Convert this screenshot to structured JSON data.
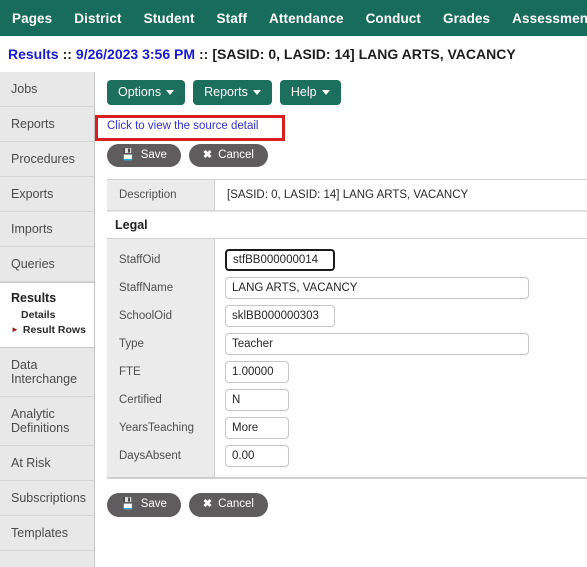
{
  "topnav": {
    "items": [
      {
        "label": "Pages"
      },
      {
        "label": "District"
      },
      {
        "label": "Student"
      },
      {
        "label": "Staff"
      },
      {
        "label": "Attendance"
      },
      {
        "label": "Conduct"
      },
      {
        "label": "Grades"
      },
      {
        "label": "Assessment"
      }
    ]
  },
  "results_bar": {
    "prefix": "Results",
    "sep1": "::",
    "timestamp": "9/26/2023 3:56 PM",
    "sep2": "::",
    "subject": "[SASID: 0, LASID: 14] LANG ARTS, VACANCY"
  },
  "sidebar": {
    "items_top": [
      {
        "label": "Jobs"
      },
      {
        "label": "Reports"
      },
      {
        "label": "Procedures"
      },
      {
        "label": "Exports"
      },
      {
        "label": "Imports"
      },
      {
        "label": "Queries"
      }
    ],
    "group": {
      "title": "Results",
      "sub_items": [
        {
          "label": "Details",
          "current": false
        },
        {
          "label": "Result Rows",
          "current": true
        }
      ]
    },
    "items_bottom": [
      {
        "label": "Data Interchange"
      },
      {
        "label": "Analytic Definitions"
      },
      {
        "label": "At Risk"
      },
      {
        "label": "Subscriptions"
      },
      {
        "label": "Templates"
      }
    ]
  },
  "toolbar": {
    "options_label": "Options",
    "reports_label": "Reports",
    "help_label": "Help"
  },
  "source_link": {
    "label": "Click to view the source detail",
    "highlight_color": "#d91f1f"
  },
  "actions": {
    "save_label": "Save",
    "cancel_label": "Cancel",
    "save_icon": "floppy-disk-icon",
    "cancel_icon": "close-x-icon"
  },
  "detail": {
    "description_label": "Description",
    "description_value": "[SASID: 0, LASID: 14] LANG ARTS, VACANCY",
    "tab_label": "Legal",
    "fields": [
      {
        "label": "StaffOid",
        "value": "stfBB000000014",
        "width": "w-md",
        "focused": true
      },
      {
        "label": "StaffName",
        "value": "LANG ARTS, VACANCY",
        "width": "w-lg",
        "focused": false
      },
      {
        "label": "SchoolOid",
        "value": "sklBB000000303",
        "width": "w-md",
        "focused": false
      },
      {
        "label": "Type",
        "value": "Teacher",
        "width": "w-lg",
        "focused": false
      },
      {
        "label": "FTE",
        "value": "1.00000",
        "width": "w-sm",
        "focused": false
      },
      {
        "label": "Certified",
        "value": "N",
        "width": "w-sm",
        "focused": false
      },
      {
        "label": "YearsTeaching",
        "value": "More",
        "width": "w-sm",
        "focused": false
      },
      {
        "label": "DaysAbsent",
        "value": "0.00",
        "width": "w-sm",
        "focused": false
      }
    ]
  },
  "theme": {
    "nav_green": "#176c5c",
    "button_green": "#1c6e5d",
    "gray_button": "#5e5c5c",
    "link_blue": "#3333cc",
    "title_blue": "#1a1ad0"
  }
}
